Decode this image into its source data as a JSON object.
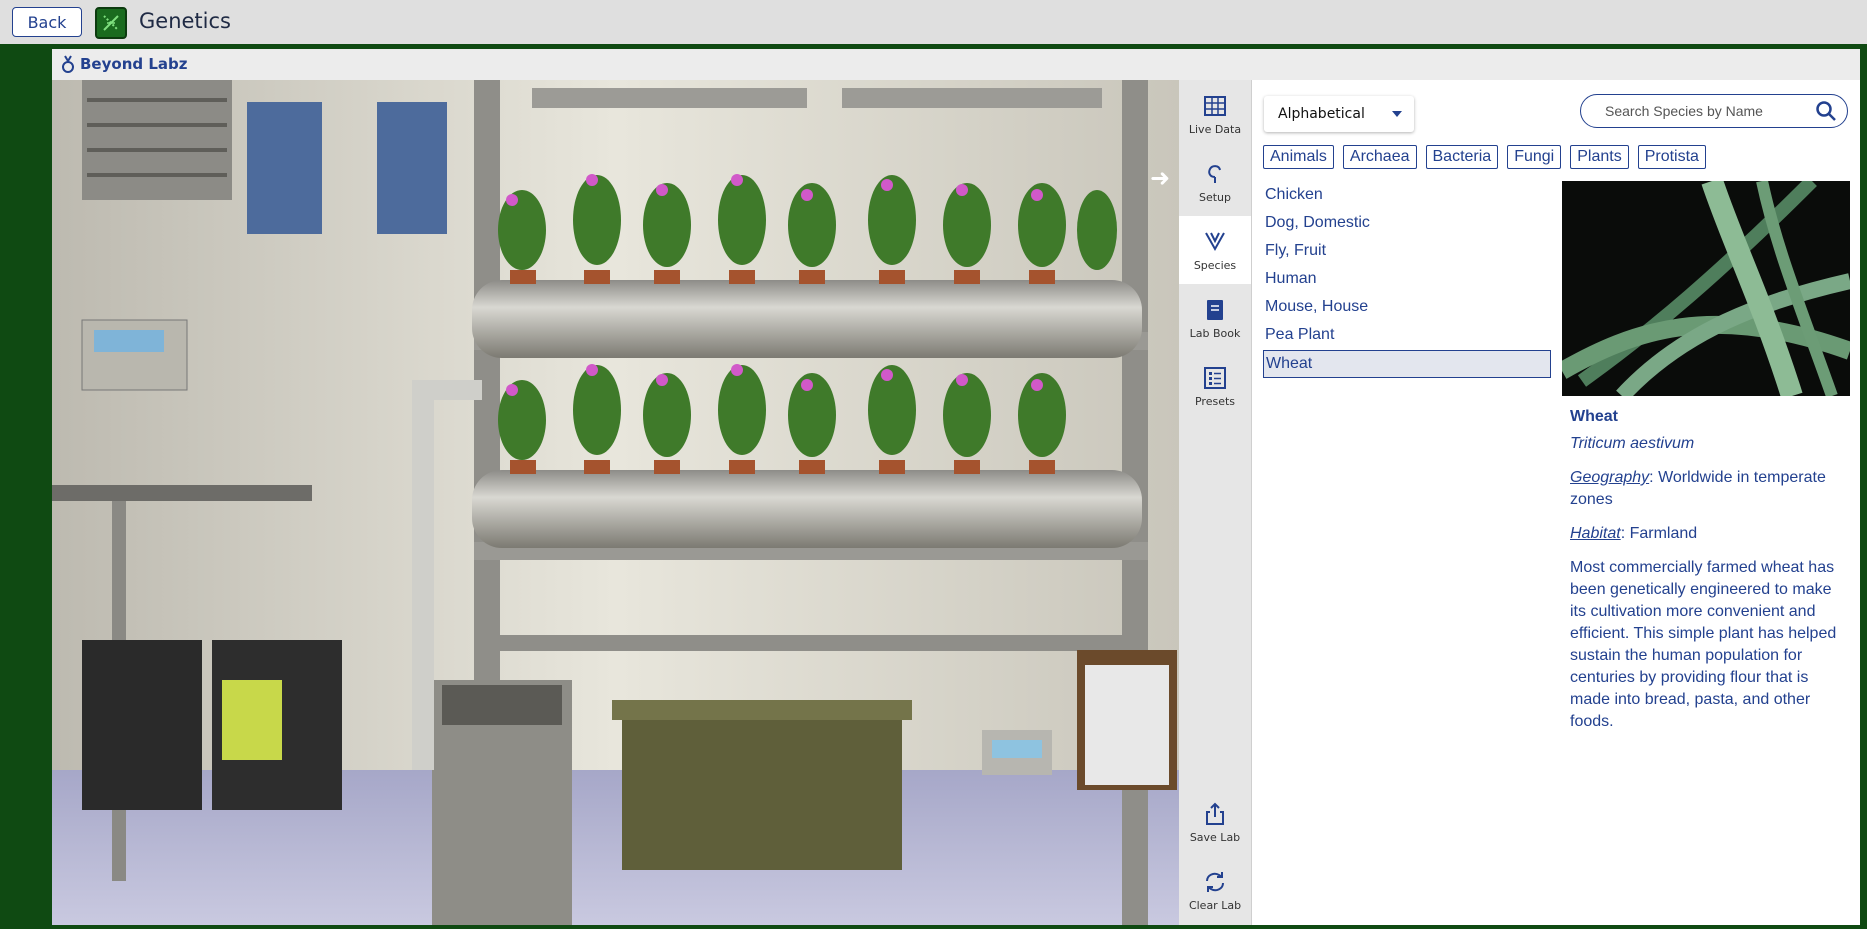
{
  "appbar": {
    "back_label": "Back",
    "title": "Genetics",
    "app_icon": "dna-icon"
  },
  "brand": {
    "name": "Beyond Labz",
    "logo_icon": "beyond-labz-logo-icon"
  },
  "toolbar": {
    "items": [
      {
        "label": "Live Data",
        "icon": "table-grid-icon"
      },
      {
        "label": "Setup",
        "icon": "setup-hook-icon"
      },
      {
        "label": "Species",
        "icon": "species-branch-icon",
        "active": true
      },
      {
        "label": "Lab Book",
        "icon": "book-icon"
      },
      {
        "label": "Presets",
        "icon": "list-icon"
      },
      {
        "label": "Save Lab",
        "icon": "share-upload-icon"
      },
      {
        "label": "Clear Lab",
        "icon": "refresh-icon"
      }
    ]
  },
  "panel": {
    "sort_value": "Alphabetical",
    "search_placeholder": "Search Species by Name",
    "filters": [
      "Animals",
      "Archaea",
      "Bacteria",
      "Fungi",
      "Plants",
      "Protista"
    ],
    "species": [
      "Chicken",
      "Dog, Domestic",
      "Fly, Fruit",
      "Human",
      "Mouse, House",
      "Pea Plant",
      "Wheat"
    ],
    "selected_species": "Wheat",
    "detail": {
      "name": "Wheat",
      "scientific_name": "Triticum aestivum",
      "geography_label": "Geography",
      "geography_value": ": Worldwide in temperate zones",
      "habitat_label": "Habitat",
      "habitat_value": ": Farmland",
      "description": "Most commercially farmed wheat has been genetically engineered to make its cultivation more convenient and efficient. This simple plant has helped sustain the human population for centuries by providing flour that is made into bread, pasta, and other foods."
    }
  },
  "colors": {
    "accent": "#23418f",
    "frame_bg": "#0f4a12",
    "app_icon_bg": "#1a6b1f"
  }
}
